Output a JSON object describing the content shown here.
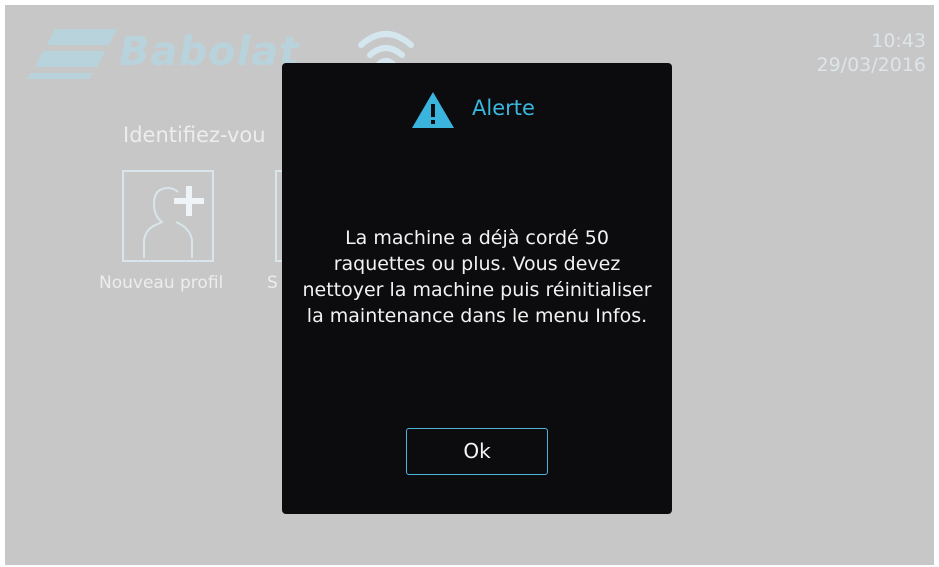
{
  "header": {
    "brand": "Babolat",
    "time": "10:43",
    "date": "29/03/2016",
    "icons": [
      "babolat-logo-icon",
      "wifi-icon"
    ]
  },
  "login": {
    "prompt": "Identifiez-vou",
    "tiles": [
      {
        "label": "Nouveau profil",
        "icon": "add-user-icon"
      },
      {
        "label": "S",
        "icon": "profile-icon"
      }
    ]
  },
  "alert": {
    "icon": "warning-icon",
    "title": "Alerte",
    "message": "La machine a déjà cordé 50 raquettes ou plus. Vous devez nettoyer la machine puis réinitialiser la maintenance dans le menu Infos.",
    "ok_label": "Ok"
  },
  "colors": {
    "background": "#c7c7c7",
    "dialog": "#0c0c0e",
    "accent": "#39b7df",
    "logo": "#b9d3dc"
  }
}
